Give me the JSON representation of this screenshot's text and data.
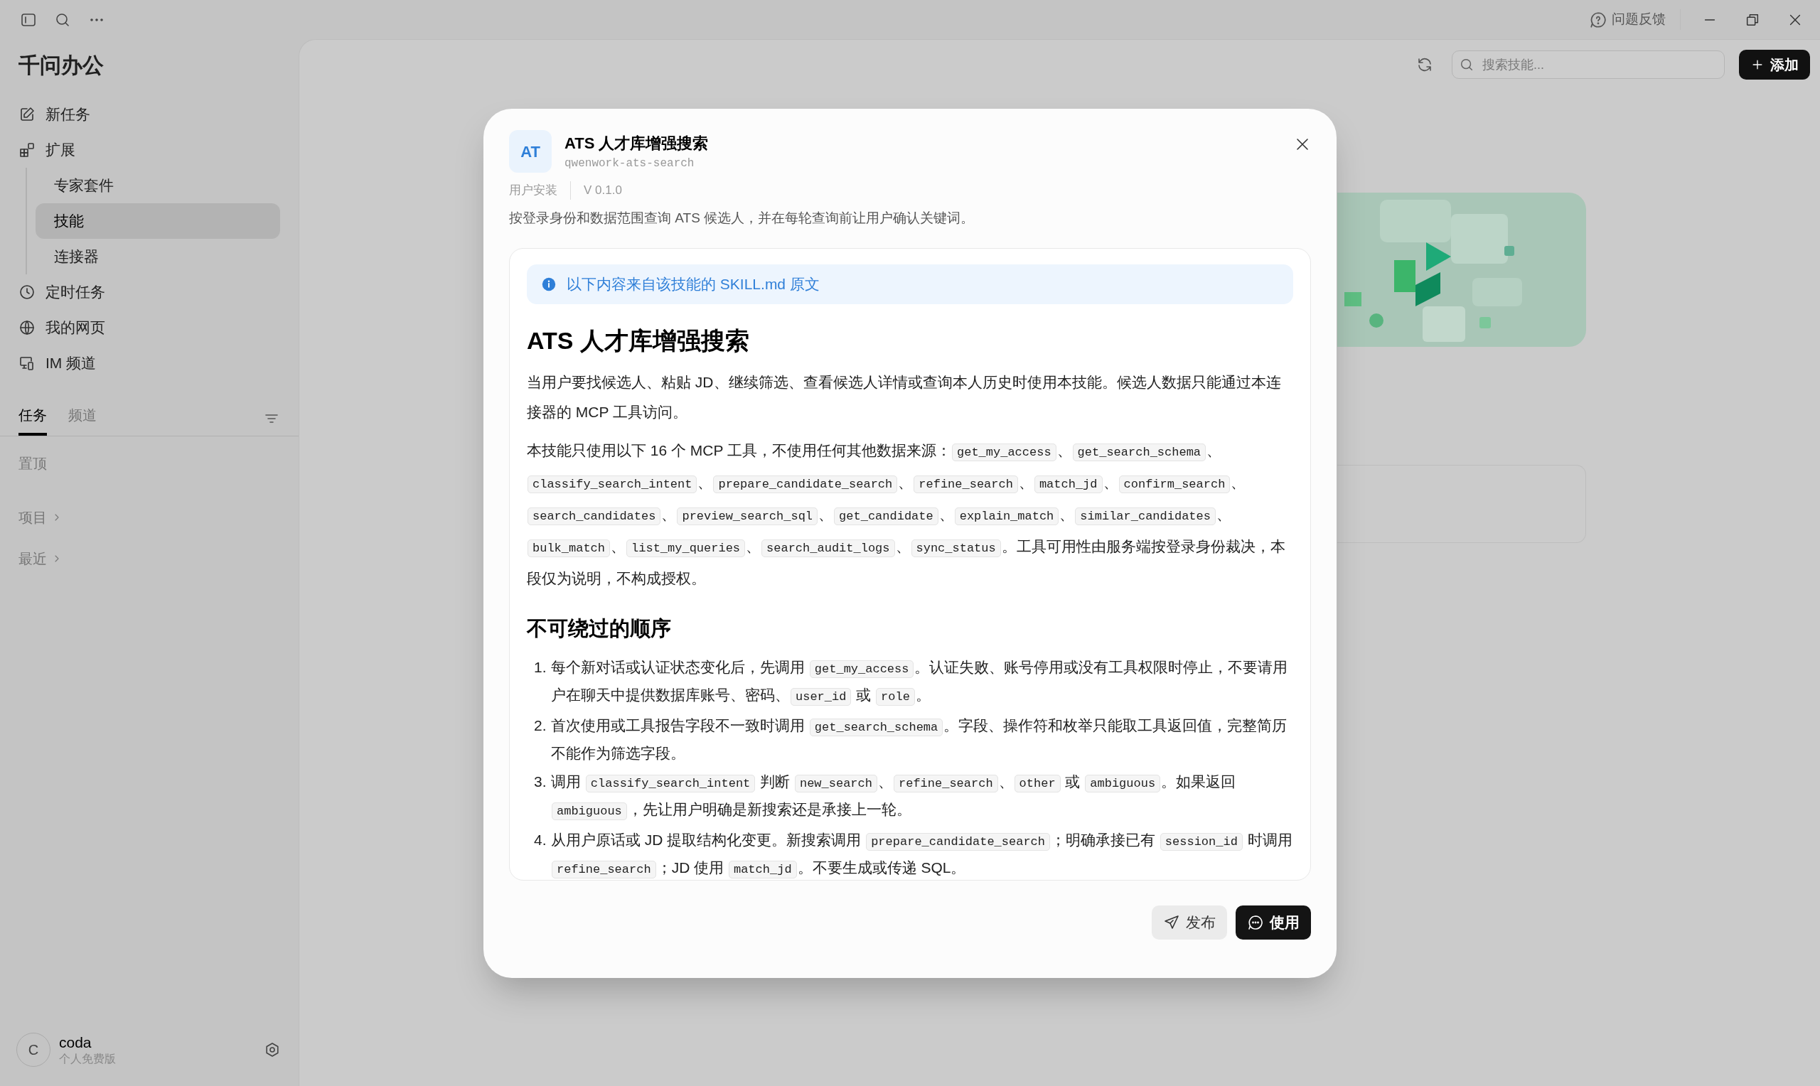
{
  "window": {
    "feedback": "问题反馈"
  },
  "sidebar": {
    "title": "千问办公",
    "nav": [
      {
        "label": "新任务",
        "kind": "edit",
        "selected": false
      },
      {
        "label": "扩展",
        "kind": "grid",
        "selected": false,
        "children": [
          {
            "label": "专家套件",
            "selected": false
          },
          {
            "label": "技能",
            "selected": true
          },
          {
            "label": "连接器",
            "selected": false
          }
        ]
      },
      {
        "label": "定时任务",
        "kind": "clock",
        "selected": false
      },
      {
        "label": "我的网页",
        "kind": "globe",
        "selected": false
      },
      {
        "label": "IM 频道",
        "kind": "devices",
        "selected": false
      }
    ],
    "tabs": [
      {
        "label": "任务",
        "selected": true
      },
      {
        "label": "频道",
        "selected": false
      }
    ],
    "sections": [
      {
        "label": "置顶",
        "kind": "plain"
      },
      {
        "label": "项目",
        "kind": "expandable"
      },
      {
        "label": "最近",
        "kind": "expandable"
      }
    ],
    "user": {
      "avatar": "C",
      "name": "coda",
      "plan": "个人免费版"
    }
  },
  "toolbar": {
    "search": {
      "placeholder": "搜索技能..."
    },
    "add_button": "添加"
  },
  "dialog": {
    "badge": "AT",
    "title": "ATS 人才库增强搜索",
    "slug": "qwenwork-ats-search",
    "source": "用户安装",
    "version": "V 0.1.0",
    "description": "按登录身份和数据范围查询 ATS 候选人，并在每轮查询前让用户确认关键词。",
    "notice": "以下内容来自该技能的 SKILL.md 原文",
    "doc": [
      {
        "kind": "h1",
        "text": "ATS 人才库增强搜索"
      },
      {
        "kind": "p",
        "parts": [
          {
            "text": "当用户要找候选人、粘贴 JD、继续筛选、查看候选人详情或查询本人历史时使用本技能。候选人数据只能通过本连接器的 MCP 工具访问。"
          }
        ]
      },
      {
        "kind": "p",
        "parts": [
          {
            "text": "本技能只使用以下 16 个 MCP 工具，不使用任何其他数据来源："
          },
          {
            "code": "get_my_access"
          },
          {
            "text": "、"
          },
          {
            "code": "get_search_schema"
          },
          {
            "text": "、"
          },
          {
            "code": "classify_search_intent"
          },
          {
            "text": "、"
          },
          {
            "code": "prepare_candidate_search"
          },
          {
            "text": "、"
          },
          {
            "code": "refine_search"
          },
          {
            "text": "、"
          },
          {
            "code": "match_jd"
          },
          {
            "text": "、"
          },
          {
            "code": "confirm_search"
          },
          {
            "text": "、"
          },
          {
            "code": "search_candidates"
          },
          {
            "text": "、"
          },
          {
            "code": "preview_search_sql"
          },
          {
            "text": "、"
          },
          {
            "code": "get_candidate"
          },
          {
            "text": "、"
          },
          {
            "code": "explain_match"
          },
          {
            "text": "、"
          },
          {
            "code": "similar_candidates"
          },
          {
            "text": "、"
          },
          {
            "code": "bulk_match"
          },
          {
            "text": "、"
          },
          {
            "code": "list_my_queries"
          },
          {
            "text": "、"
          },
          {
            "code": "search_audit_logs"
          },
          {
            "text": "、"
          },
          {
            "code": "sync_status"
          },
          {
            "text": "。工具可用性由服务端按登录身份裁决，本段仅为说明，不构成授权。"
          }
        ]
      },
      {
        "kind": "h2",
        "text": "不可绕过的顺序"
      },
      {
        "kind": "ol",
        "items": [
          {
            "number": "1.",
            "parts": [
              {
                "text": "每个新对话或认证状态变化后，先调用 "
              },
              {
                "code": "get_my_access"
              },
              {
                "text": "。认证失败、账号停用或没有工具权限时停止，不要请用户在聊天中提供数据库账号、密码、"
              },
              {
                "code": "user_id"
              },
              {
                "text": " 或 "
              },
              {
                "code": "role"
              },
              {
                "text": "。"
              }
            ]
          },
          {
            "number": "2.",
            "parts": [
              {
                "text": "首次使用或工具报告字段不一致时调用 "
              },
              {
                "code": "get_search_schema"
              },
              {
                "text": "。字段、操作符和枚举只能取工具返回值，完整简历不能作为筛选字段。"
              }
            ]
          },
          {
            "number": "3.",
            "parts": [
              {
                "text": "调用 "
              },
              {
                "code": "classify_search_intent"
              },
              {
                "text": " 判断 "
              },
              {
                "code": "new_search"
              },
              {
                "text": "、"
              },
              {
                "code": "refine_search"
              },
              {
                "text": "、"
              },
              {
                "code": "other"
              },
              {
                "text": " 或 "
              },
              {
                "code": "ambiguous"
              },
              {
                "text": "。如果返回 "
              },
              {
                "code": "ambiguous"
              },
              {
                "text": "，先让用户明确是新搜索还是承接上一轮。"
              }
            ]
          },
          {
            "number": "4.",
            "parts": [
              {
                "text": "从用户原话或 JD 提取结构化变更。新搜索调用 "
              },
              {
                "code": "prepare_candidate_search"
              },
              {
                "text": "；明确承接已有 "
              },
              {
                "code": "session_id"
              },
              {
                "text": " 时调用 "
              },
              {
                "code": "refine_search"
              },
              {
                "text": "；JD 使用 "
              },
              {
                "code": "match_jd"
              },
              {
                "text": "。不要生成或传递 SQL。"
              }
            ]
          }
        ]
      }
    ],
    "buttons": [
      {
        "label": "发布",
        "kind": "secondary"
      },
      {
        "label": "使用",
        "kind": "primary"
      }
    ]
  }
}
